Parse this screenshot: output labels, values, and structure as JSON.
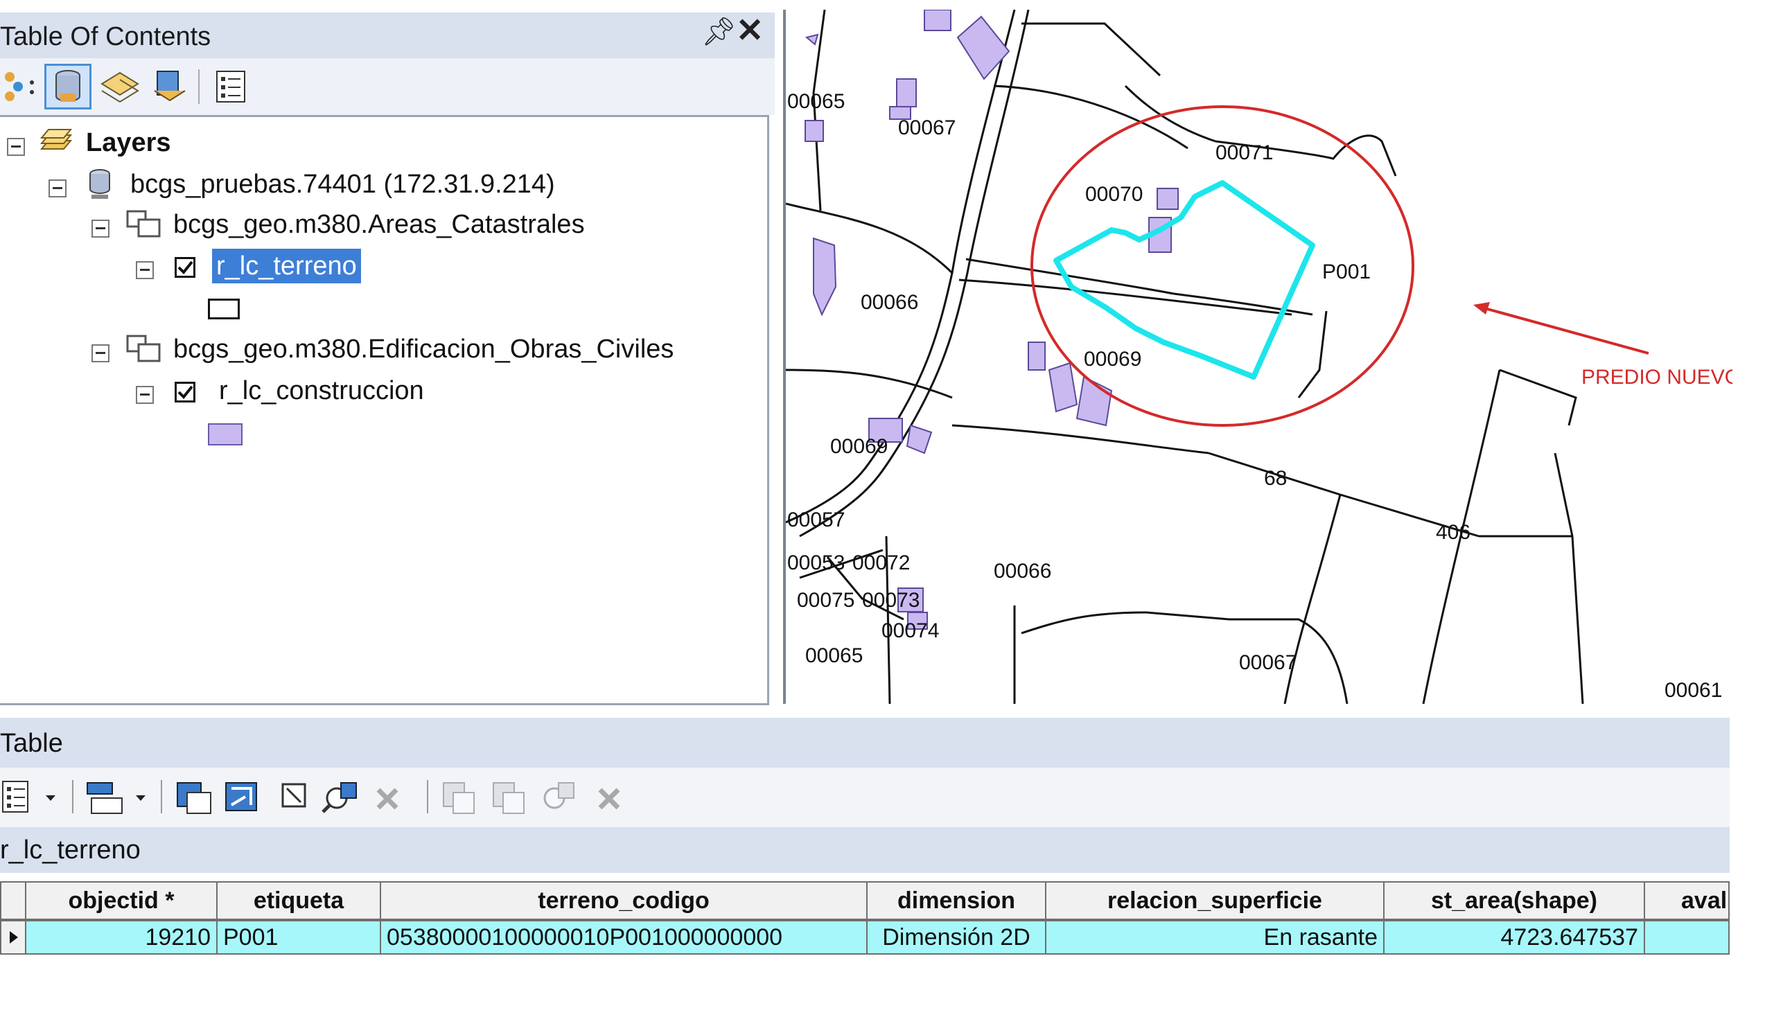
{
  "toc": {
    "title": "Table Of Contents",
    "layers_label": "Layers",
    "connection_label": "bcgs_pruebas.74401 (172.31.9.214)",
    "group1_label": "bcgs_geo.m380.Areas_Catastrales",
    "layer1_label": "r_lc_terreno",
    "group2_label": "bcgs_geo.m380.Edificacion_Obras_Civiles",
    "layer2_label": "r_lc_construccion",
    "layer1_checked": true,
    "layer2_checked": true
  },
  "map": {
    "labels": [
      "00065",
      "00067",
      "00071",
      "00070",
      "P001",
      "00066",
      "00069",
      "00069",
      "68",
      "406",
      "00057",
      "00053",
      "00072",
      "00075",
      "00073",
      "00066",
      "00074",
      "00065",
      "00067",
      "00061"
    ],
    "annotation": "PREDIO NUEVO",
    "colors": {
      "highlight": "#1de5ec",
      "annotation": "#d42a2a",
      "building": "#c9b9f0"
    }
  },
  "table": {
    "window_title": "Table",
    "tab_label": "r_lc_terreno",
    "columns": [
      "objectid *",
      "etiqueta",
      "terreno_codigo",
      "dimension",
      "relacion_superficie",
      "st_area(shape)",
      "aval"
    ],
    "row": [
      "19210",
      "P001",
      "05380000100000010P001000000000",
      "Dimensión 2D",
      "En rasante",
      "4723.647537",
      ""
    ]
  }
}
